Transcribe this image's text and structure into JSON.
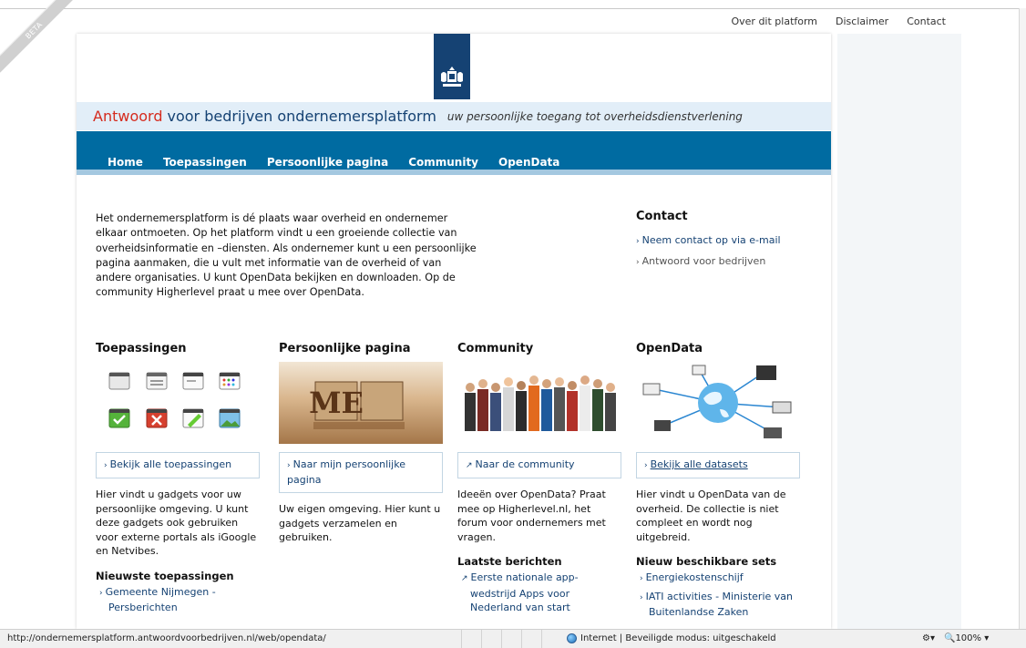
{
  "beta_ribbon": "BETA",
  "top_links": [
    "Over dit platform",
    "Disclaimer",
    "Contact"
  ],
  "tagline": {
    "brand": "Antwoord",
    "rest": "voor bedrijven ondernemersplatform",
    "slogan": "uw persoonlijke toegang tot overheidsdienstverlening"
  },
  "nav": [
    "Home",
    "Toepassingen",
    "Persoonlijke pagina",
    "Community",
    "OpenData"
  ],
  "intro": "Het ondernemersplatform is dé plaats waar overheid en ondernemer elkaar ontmoeten. Op het platform vindt u een groeiende collectie van overheidsinformatie en –diensten. Als ondernemer kunt u een persoonlijke pagina aanmaken, die u vult met informatie van de overheid of van andere organisaties. U kunt OpenData bekijken en downloaden. Op de community Higherlevel praat u mee over OpenData.",
  "contact": {
    "title": "Contact",
    "links": [
      "Neem contact op via e-mail",
      "Antwoord voor bedrijven"
    ]
  },
  "columns": [
    {
      "title": "Toepassingen",
      "link": "Bekijk alle toepassingen",
      "desc": "Hier vindt u gadgets voor uw persoonlijke omgeving. U kunt deze gadgets ook gebruiken voor externe portals als iGoogle en Netvibes.",
      "sub_title": "Nieuwste toepassingen",
      "sub_items": [
        "Gemeente Nijmegen - Persberichten"
      ]
    },
    {
      "title": "Persoonlijke pagina",
      "link": "Naar mijn persoonlijke pagina",
      "desc": "Uw eigen omgeving. Hier kunt u gadgets verzamelen en gebruiken.",
      "image_text": "ME"
    },
    {
      "title": "Community",
      "link": "Naar de community",
      "desc": "Ideeën over OpenData? Praat mee op Higherlevel.nl, het forum voor ondernemers met vragen.",
      "sub_title": "Laatste berichten",
      "sub_items": [
        "Eerste nationale app-wedstrijd Apps voor Nederland van start"
      ]
    },
    {
      "title": "OpenData",
      "link": "Bekijk alle datasets",
      "desc": "Hier vindt u OpenData van de overheid. De collectie is niet compleet en wordt nog uitgebreid.",
      "sub_title": "Nieuw beschikbare sets",
      "sub_items": [
        "Energiekostenschijf",
        "IATI activities - Ministerie van Buitenlandse Zaken"
      ]
    }
  ],
  "status": {
    "url": "http://ondernemersplatform.antwoordvoorbedrijven.nl/web/opendata/",
    "zone": "Internet | Beveiligde modus: uitgeschakeld",
    "zoom": "100%"
  },
  "colors": {
    "nav_blue": "#006ba1",
    "brand_red": "#d52b1e",
    "dark_blue": "#154273",
    "tag_bg": "#e2eef8"
  }
}
